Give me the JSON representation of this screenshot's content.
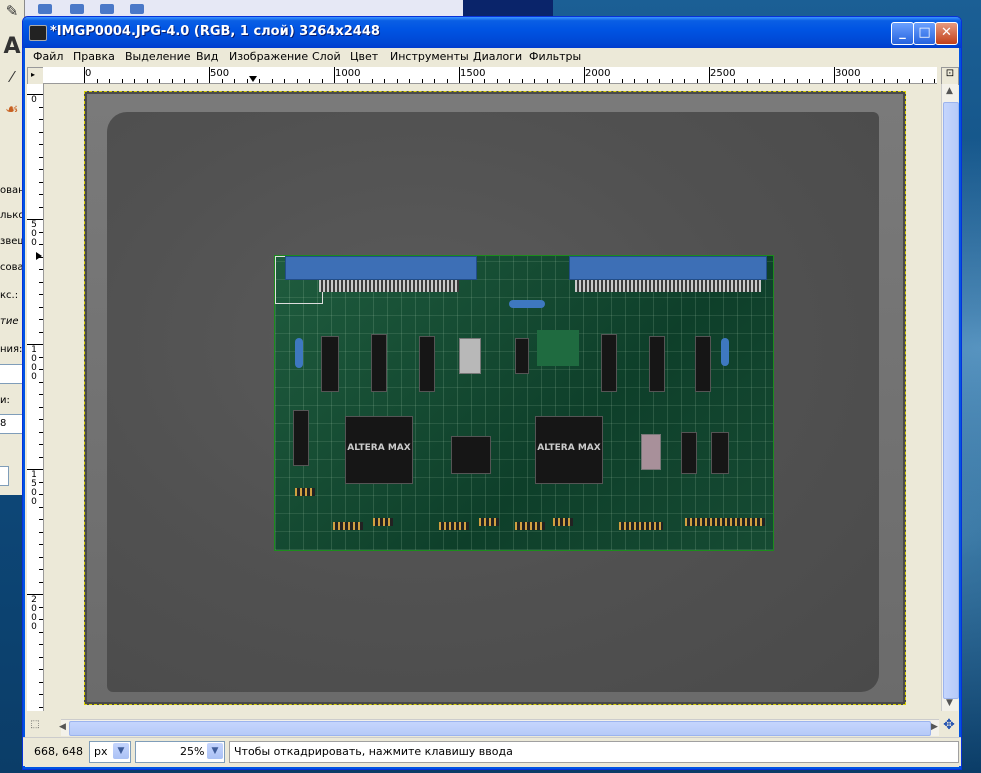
{
  "window": {
    "title": "*IMGP0004.JPG-4.0 (RGB, 1 слой) 3264x2448",
    "min_label": "_",
    "max_label": "□",
    "close_label": "✕"
  },
  "menu": [
    "Файл",
    "Правка",
    "Выделение",
    "Вид",
    "Изображение",
    "Слой",
    "Цвет",
    "Инструменты",
    "Диалоги",
    "Фильтры"
  ],
  "ruler_top_labels": [
    "0",
    "500",
    "1000",
    "1500",
    "2000",
    "2500",
    "3000"
  ],
  "ruler_left_labels": [
    "0",
    "5\n0\n0",
    "1\n0\n0\n0",
    "1\n5\n0\n0",
    "2\n0\n0\n0"
  ],
  "toolbox": {
    "labels": [
      "ован",
      "лько",
      "звещ",
      "сова",
      "кс.:",
      "тие",
      "ния:",
      "и:"
    ],
    "field_value": "8"
  },
  "board": {
    "chip_label_1": "ALTERA MAX",
    "chip_label_2": "ALTERA MAX"
  },
  "statusbar": {
    "coords": "668, 648",
    "unit": "px",
    "zoom": "25%",
    "message": "Чтобы откадрировать, нажмите клавишу ввода"
  }
}
